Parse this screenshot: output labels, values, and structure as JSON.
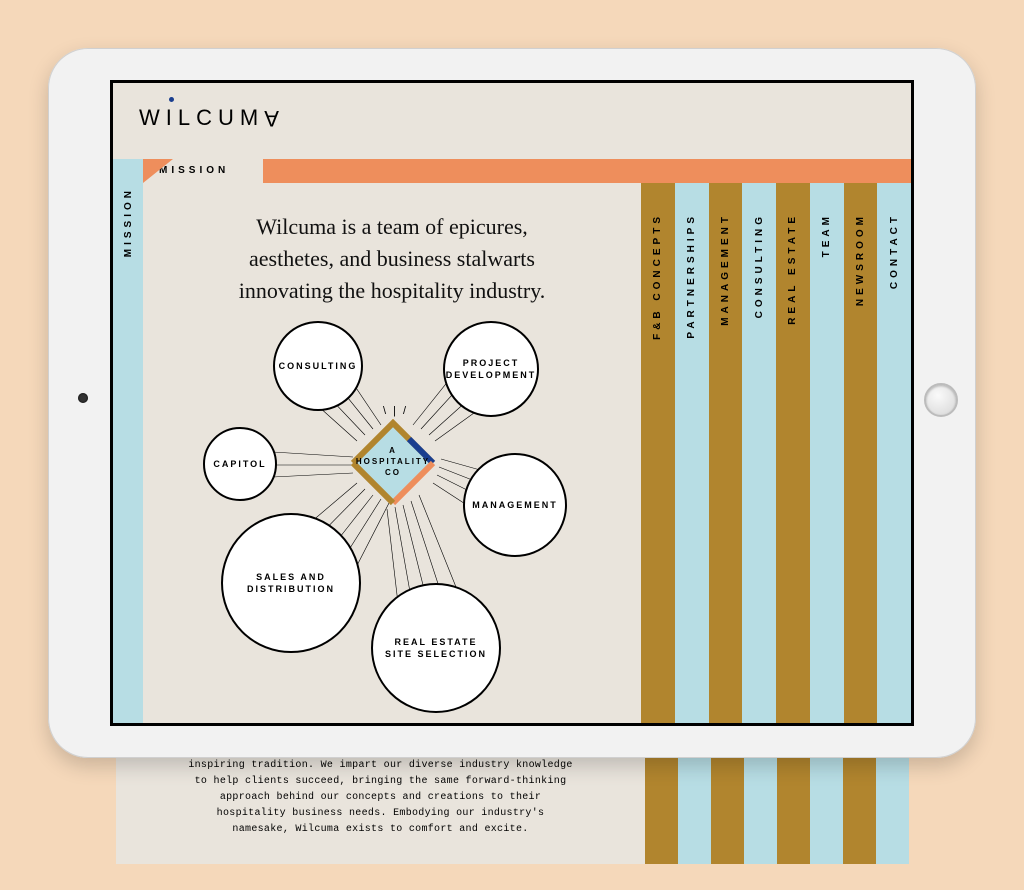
{
  "logo": "WILCUM",
  "logo_last": "A",
  "active_tab": "MISSION",
  "side_label": "MISSION",
  "intro": "Wilcuma is a team of epicures, aesthetes, and business stalwarts innovating the hospitality industry.",
  "hub_label": "A\nHOSPITALITY\nCO",
  "bubbles": {
    "consulting": "CONSULTING",
    "project_dev": "PROJECT\nDEVELOPMENT",
    "capitol": "CAPITOL",
    "management": "MANAGEMENT",
    "sales": "SALES AND\nDISTRIBUTION",
    "realestate": "REAL ESTATE\nSITE SELECTION"
  },
  "nav": [
    {
      "label": "F&B CONCEPTS",
      "color": "brown"
    },
    {
      "label": "PARTNERSHIPS",
      "color": "blue"
    },
    {
      "label": "MANAGEMENT",
      "color": "brown"
    },
    {
      "label": "CONSULTING",
      "color": "blue"
    },
    {
      "label": "REAL ESTATE",
      "color": "brown"
    },
    {
      "label": "TEAM",
      "color": "blue"
    },
    {
      "label": "NEWSROOM",
      "color": "brown"
    },
    {
      "label": "CONTACT",
      "color": "blue"
    }
  ],
  "body_copy": "Our team reimagines familiar food and beverage experiences, inspiring tradition. We impart our diverse industry knowledge to help clients succeed, bringing the same forward-thinking approach behind our concepts and creations to their hospitality business needs. Embodying our industry's namesake, Wilcuma exists to comfort and excite.",
  "colors": {
    "peach_bg": "#f5d8ba",
    "cream": "#e9e4dc",
    "orange": "#ee8e5c",
    "lightblue": "#b7dde4",
    "brown": "#b1852e",
    "navy": "#1a3e8f"
  }
}
